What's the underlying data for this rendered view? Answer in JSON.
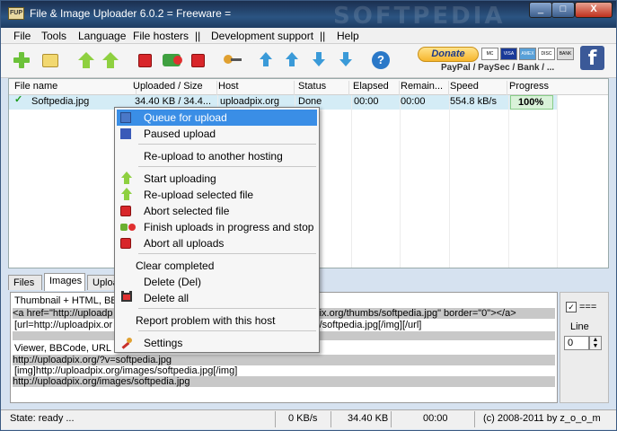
{
  "window": {
    "title": "File & Image Uploader 6.0.2  = Freeware =",
    "app_icon": "FUP",
    "watermark": "SOFTPEDIA",
    "min_label": "_",
    "max_label": "□",
    "close_label": "X"
  },
  "menu": {
    "items": [
      "File",
      "Tools",
      "Language",
      "File hosters",
      "||",
      "Development support",
      "||",
      "Help"
    ]
  },
  "toolbar": {
    "donate_label": "Donate",
    "payment_text": "PayPal / PaySec / Bank / ...",
    "help_label": "?",
    "facebook_label": "f",
    "cards": [
      "MC",
      "VISA",
      "AMEX",
      "DISC",
      "BANK"
    ]
  },
  "list": {
    "columns": [
      "File name",
      "Uploaded / Size",
      "Host",
      "Status",
      "Elapsed",
      "Remain...",
      "Speed",
      "Progress"
    ],
    "rows": [
      {
        "check": "✓",
        "file": "Softpedia.jpg",
        "uploaded": "34.40 KB / 34.4...",
        "host": "uploadpix.org",
        "status": "Done",
        "elapsed": "00:00",
        "remain": "00:00",
        "speed": "554.8 kB/s",
        "progress": "100%"
      }
    ]
  },
  "context_menu": {
    "items": [
      "Queue for upload",
      "Paused upload",
      "Re-upload to another hosting",
      "Start uploading",
      "Re-upload selected file",
      "Abort selected file",
      "Finish uploads in progress and stop",
      "Abort all uploads",
      "Clear completed",
      "Delete (Del)",
      "Delete all",
      "Report problem with this host",
      "Settings"
    ]
  },
  "tabs": [
    "Files",
    "Images",
    "Upload"
  ],
  "links": {
    "line1": "Thumbnail + HTML, BBCo",
    "line2a": "<a href=\"http://uploadp",
    "line2b": "xpix.org/thumbs/softpedia.jpg\" border=\"0\"></a>",
    "line3a": "[url=http://uploadpix.or",
    "line3b": "bs/softpedia.jpg[/img][/url]",
    "line4": "Viewer, BBCode, URL",
    "line5": "http://uploadpix.org/?v=softpedia.jpg",
    "line6": "[img]http://uploadpix.org/images/softpedia.jpg[/img]",
    "line7": "http://uploadpix.org/images/softpedia.jpg"
  },
  "side": {
    "checkbox": "✓",
    "equals": "===",
    "line_label": "Line",
    "line_value": "0"
  },
  "status": {
    "state": "State: ready ...",
    "speed": "0 KB/s",
    "size": "34.40 KB",
    "time": "00:00",
    "copyright": "(c) 2008-2011 by z_o_o_m"
  }
}
